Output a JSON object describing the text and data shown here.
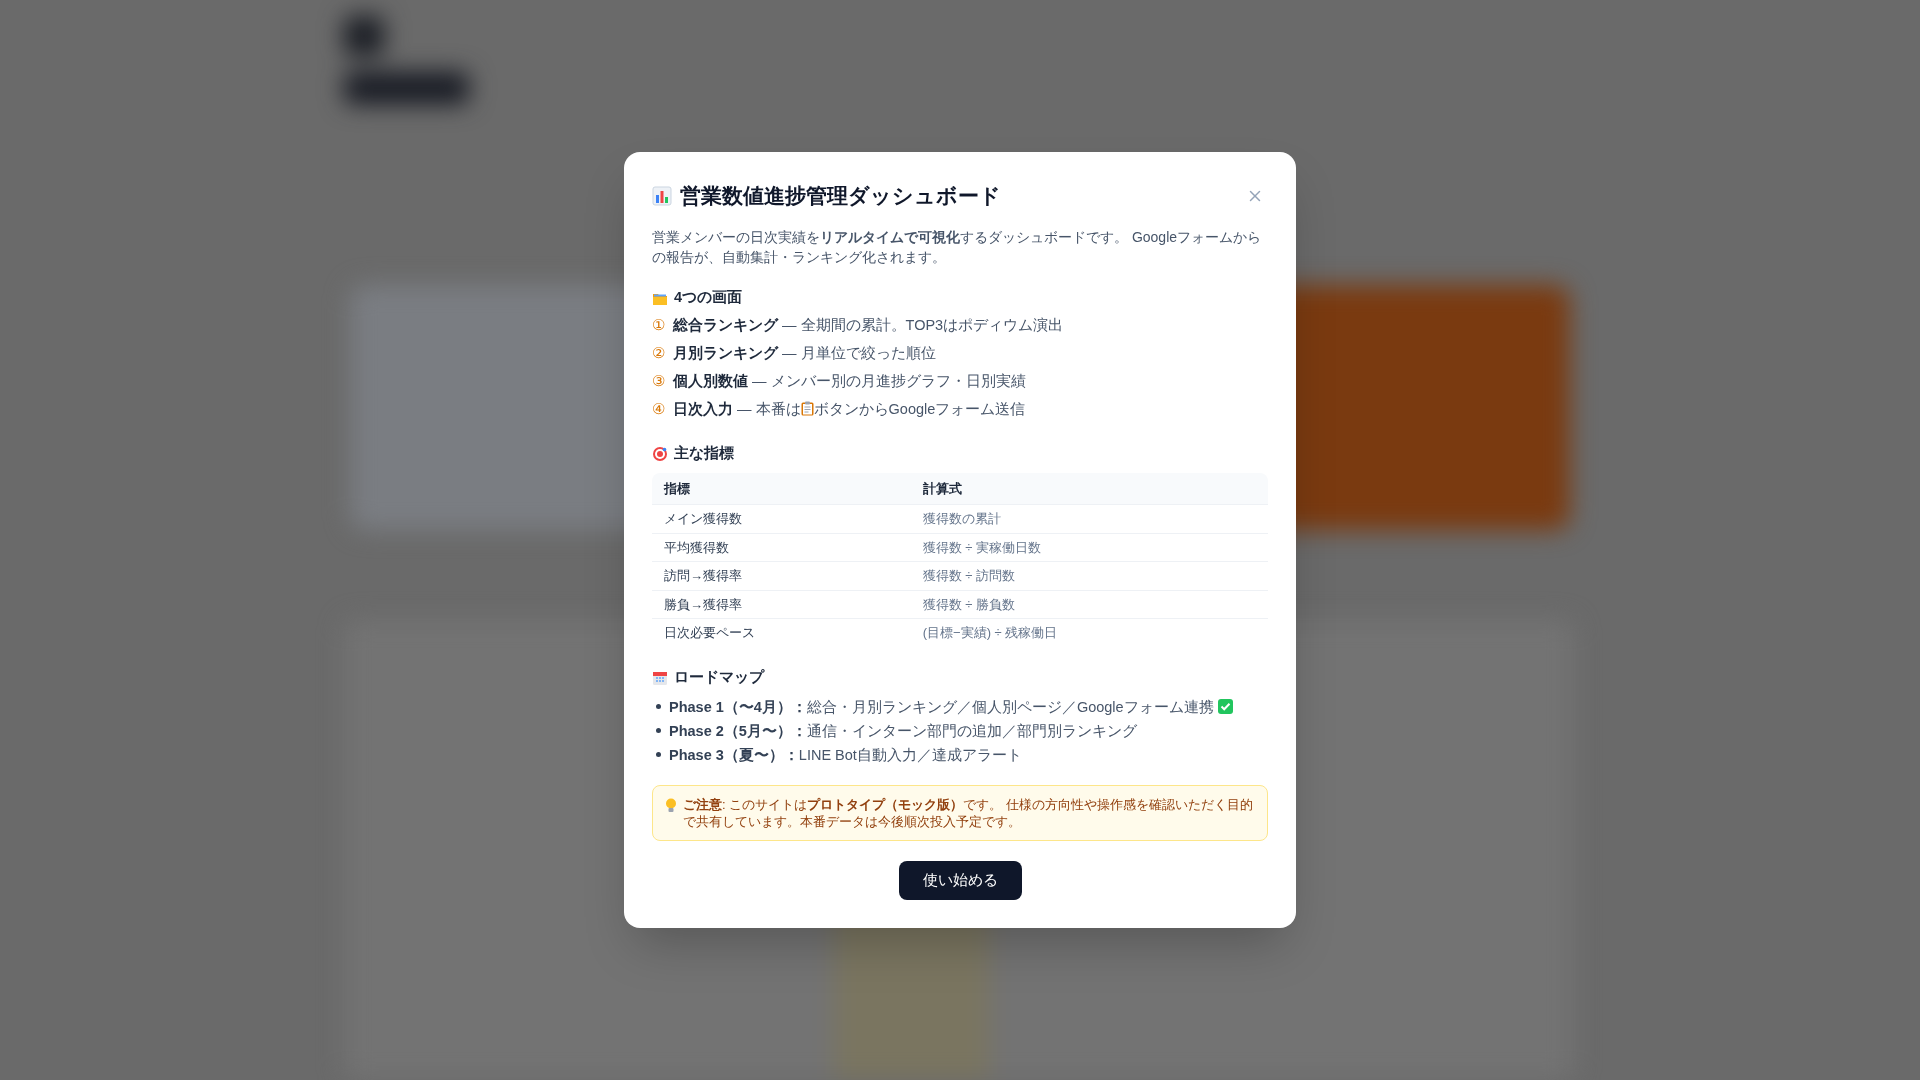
{
  "modal": {
    "title": "営業数値進捗管理ダッシュボード",
    "intro": "営業メンバーの日次実績を**リアルタイムで可視化**するダッシュボードです。 Googleフォームからの報告が、自動集計・ランキング化されます。",
    "screens": {
      "heading": "4つの画面",
      "items": [
        {
          "marker": "①",
          "name": "総合ランキング",
          "description": [
            "— 全期間の累計。TOP3はポディウム演出"
          ]
        },
        {
          "marker": "②",
          "name": "月別ランキング",
          "description": [
            "— 月単位で絞った順位"
          ]
        },
        {
          "marker": "③",
          "name": "個人別数値",
          "description": [
            "— メンバー別の月進捗グラフ・日別実績"
          ]
        },
        {
          "marker": "④",
          "name": "日次入力",
          "description": [
            "— 本番は",
            "ボタンからGoogleフォーム送信"
          ]
        }
      ]
    },
    "metrics": {
      "heading": "主な指標",
      "columns": [
        "指標",
        "計算式"
      ],
      "rows": [
        [
          "メイン獲得数",
          "獲得数の累計"
        ],
        [
          "平均獲得数",
          "獲得数 ÷ 実稼働日数"
        ],
        [
          "訪問→獲得率",
          "獲得数 ÷ 訪問数"
        ],
        [
          "勝負→獲得率",
          "獲得数 ÷ 勝負数"
        ],
        [
          "日次必要ペース",
          "(目標−実績) ÷ 残稼働日"
        ]
      ]
    },
    "roadmap": {
      "heading": "ロードマップ",
      "items": [
        {
          "label": "Phase 1（〜4月）：",
          "text": "総合・月別ランキング／個人別ページ／Googleフォーム連携",
          "done": true
        },
        {
          "label": "Phase 2（5月〜）：",
          "text": "通信・インターン部門の追加／部門別ランキング",
          "done": false
        },
        {
          "label": "Phase 3（夏〜）：",
          "text": "LINE Bot自動入力／達成アラート",
          "done": false
        }
      ]
    },
    "notice": "**ご注意**: このサイトは**プロトタイプ（モック版）**です。 仕様の方向性や操作感を確認いただく目的で共有しています。本番データは今後順次投入予定です。",
    "button": "使い始める"
  }
}
